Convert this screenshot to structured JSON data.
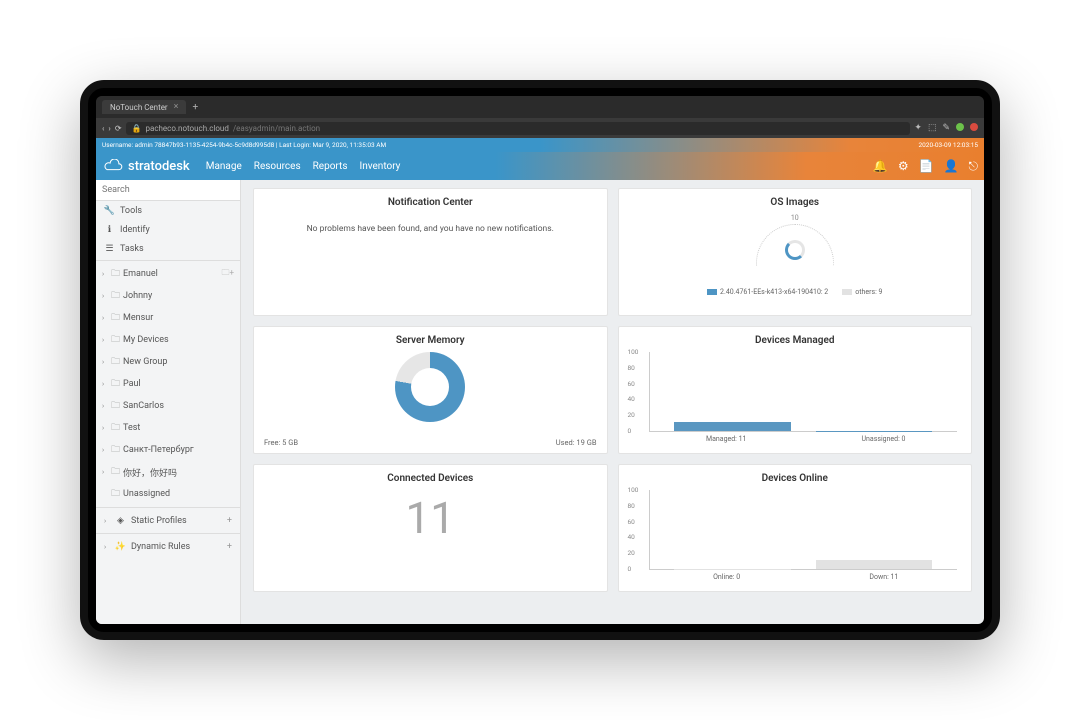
{
  "browser": {
    "tab_title": "NoTouch Center",
    "url_host": "pacheco.notouch.cloud",
    "url_path": "/easyadmin/main.action"
  },
  "status": {
    "left": "Username: admin 78847b93-1135-4254-9b4c-5c9d8d995d8 | Last Login: Mar 9, 2020, 11:35:03 AM",
    "right": "2020-03-09 12:03:15"
  },
  "brand": "stratodesk",
  "nav": [
    "Manage",
    "Resources",
    "Reports",
    "Inventory"
  ],
  "sidebar": {
    "search_placeholder": "Search",
    "util": [
      {
        "icon": "wrench-icon",
        "label": "Tools"
      },
      {
        "icon": "info-icon",
        "label": "Identify"
      },
      {
        "icon": "list-icon",
        "label": "Tasks"
      }
    ],
    "tree": [
      {
        "label": "Emanuel",
        "add": true
      },
      {
        "label": "Johnny"
      },
      {
        "label": "Mensur"
      },
      {
        "label": "My Devices"
      },
      {
        "label": "New Group"
      },
      {
        "label": "Paul"
      },
      {
        "label": "SanCarlos"
      },
      {
        "label": "Test"
      },
      {
        "label": "Санкт-Петербург"
      },
      {
        "label": "你好，你好吗"
      },
      {
        "label": "Unassigned",
        "leaf": true
      }
    ],
    "sections": [
      {
        "icon": "diamond-icon",
        "label": "Static Profiles"
      },
      {
        "icon": "wand-icon",
        "label": "Dynamic Rules"
      }
    ]
  },
  "cards": {
    "notification": {
      "title": "Notification Center",
      "body": "No problems have been found, and you have no new notifications."
    },
    "os_images": {
      "title": "OS Images",
      "tick_top": "10",
      "legend_a": "2.40.4761-EEs-k413-x64-190410: 2",
      "legend_b": "others: 9"
    },
    "server_memory": {
      "title": "Server Memory",
      "left": "Free: 5 GB",
      "right": "Used: 19 GB"
    },
    "devices_managed": {
      "title": "Devices Managed",
      "left": "Managed: 11",
      "right": "Unassigned: 0"
    },
    "connected_devices": {
      "title": "Connected Devices",
      "value": "11"
    },
    "devices_online": {
      "title": "Devices Online",
      "left": "Online: 0",
      "right": "Down: 11"
    }
  },
  "chart_data": [
    {
      "type": "pie",
      "title": "OS Images",
      "series": [
        {
          "name": "2.40.4761-EEs-k413-x64-190410",
          "value": 2
        },
        {
          "name": "others",
          "value": 9
        }
      ]
    },
    {
      "type": "pie",
      "title": "Server Memory",
      "series": [
        {
          "name": "Used",
          "value": 19,
          "unit": "GB"
        },
        {
          "name": "Free",
          "value": 5,
          "unit": "GB"
        }
      ]
    },
    {
      "type": "bar",
      "title": "Devices Managed",
      "categories": [
        "Managed",
        "Unassigned"
      ],
      "values": [
        11,
        0
      ],
      "ylim": [
        0,
        100
      ],
      "yticks": [
        0,
        20,
        40,
        60,
        80,
        100
      ]
    },
    {
      "type": "bar",
      "title": "Devices Online",
      "categories": [
        "Online",
        "Down"
      ],
      "values": [
        0,
        11
      ],
      "ylim": [
        0,
        100
      ],
      "yticks": [
        0,
        20,
        40,
        60,
        80,
        100
      ]
    }
  ],
  "colors": {
    "blue": "#4e95c4",
    "orange": "#e8843a",
    "gray": "#e2e2e2"
  }
}
